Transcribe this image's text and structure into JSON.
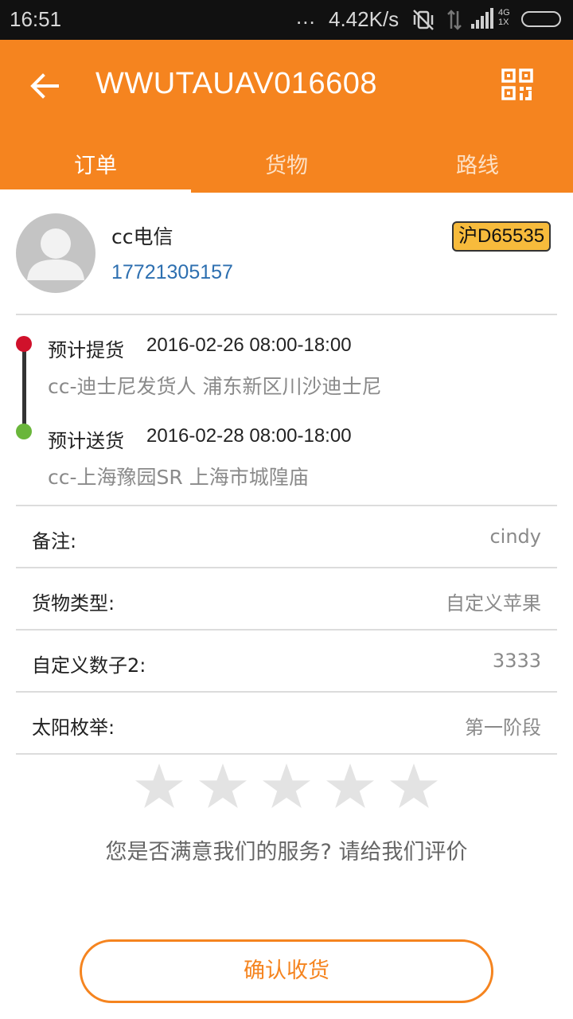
{
  "status_bar": {
    "time": "16:51",
    "dots": "...",
    "speed": "4.42K/s",
    "network_top": "4G",
    "network_bottom": "1X"
  },
  "header": {
    "title": "WWUTAUAV016608",
    "back_icon": "back-arrow-icon",
    "qr_icon": "qr-code-icon",
    "background": "#f5841f"
  },
  "tabs": [
    {
      "label": "订单",
      "active": true
    },
    {
      "label": "货物",
      "active": false
    },
    {
      "label": "路线",
      "active": false
    }
  ],
  "contact": {
    "name": "cc电信",
    "phone": "17721305157",
    "plate": "沪D65535"
  },
  "route": {
    "pickup": {
      "label": "预计提货",
      "time": "2016-02-26 08:00-18:00",
      "address": "cc-迪士尼发货人  浦东新区川沙迪士尼"
    },
    "delivery": {
      "label": "预计送货",
      "time": "2016-02-28 08:00-18:00",
      "address": "cc-上海豫园SR  上海市城隍庙"
    }
  },
  "info_rows": [
    {
      "label": "备注:",
      "value": "cindy"
    },
    {
      "label": "货物类型:",
      "value": "自定义苹果"
    },
    {
      "label": "自定义数子2:",
      "value": "3333"
    },
    {
      "label": "太阳枚举:",
      "value": "第一阶段"
    }
  ],
  "rating": {
    "stars_total": 5,
    "stars_selected": 0,
    "prompt": "您是否满意我们的服务? 请给我们评价"
  },
  "confirm_button": {
    "label": "确认收货"
  }
}
